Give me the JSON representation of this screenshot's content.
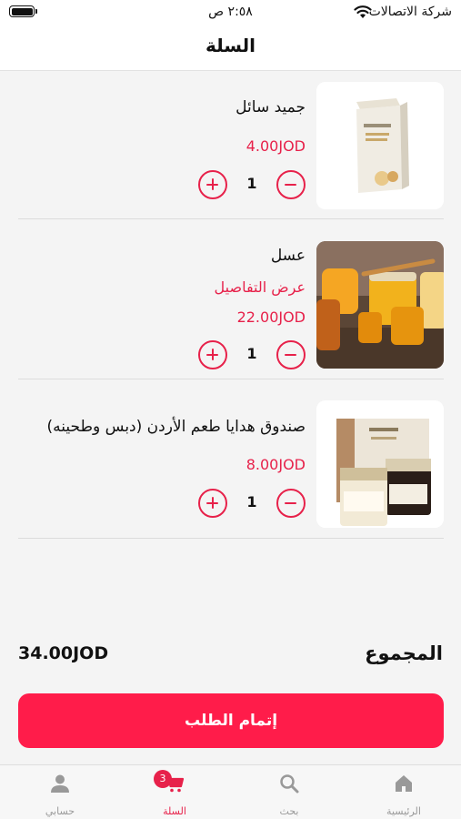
{
  "status_bar": {
    "carrier": "شركة الاتصالات",
    "time": "٢:٥٨ ص"
  },
  "header": {
    "title": "السلة"
  },
  "cart": {
    "items": [
      {
        "name": "جميد سائل",
        "price": "4.00JOD",
        "quantity": "1",
        "details_link": ""
      },
      {
        "name": "عسل",
        "price": "22.00JOD",
        "quantity": "1",
        "details_link": "عرض التفاصيل"
      },
      {
        "name": "صندوق هدايا طعم الأردن (دبس وطحينه)",
        "price": "8.00JOD",
        "quantity": "1",
        "details_link": ""
      }
    ]
  },
  "total": {
    "label": "المجموع",
    "value": "34.00JOD"
  },
  "checkout": {
    "label": "إتمام الطلب"
  },
  "tab_bar": {
    "tabs": [
      {
        "label": "الرئيسية",
        "icon": "home-icon"
      },
      {
        "label": "بحث",
        "icon": "search-icon"
      },
      {
        "label": "السلة",
        "icon": "cart-icon",
        "badge": "3",
        "active": true
      },
      {
        "label": "حسابي",
        "icon": "person-icon"
      }
    ]
  },
  "colors": {
    "accent": "#e7214a",
    "button": "#ff1c4a"
  }
}
